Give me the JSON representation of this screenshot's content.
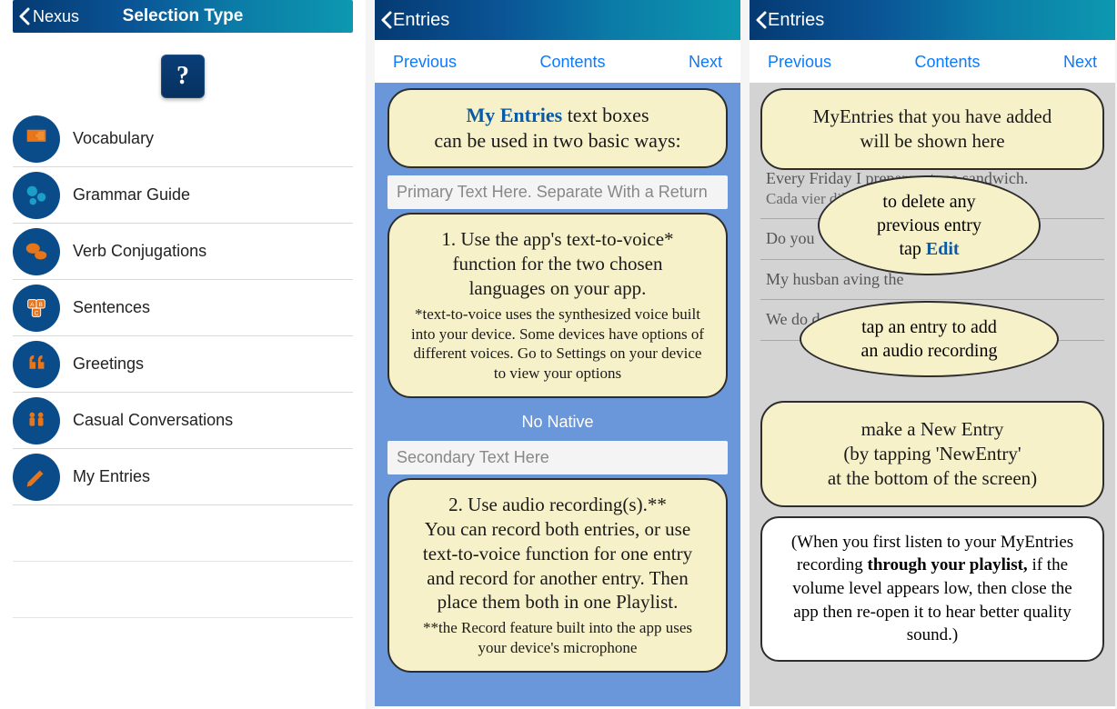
{
  "screen1": {
    "back_label": "Nexus",
    "title": "Selection Type",
    "help_glyph": "?",
    "items": [
      {
        "label": "Vocabulary"
      },
      {
        "label": "Grammar Guide"
      },
      {
        "label": "Verb Conjugations"
      },
      {
        "label": "Sentences"
      },
      {
        "label": "Greetings"
      },
      {
        "label": "Casual Conversations"
      },
      {
        "label": "My Entries"
      }
    ]
  },
  "nav": {
    "prev": "Previous",
    "contents": "Contents",
    "next": "Next"
  },
  "screen2": {
    "back_label": "Entries",
    "bubble1_a": "My Entries",
    "bubble1_b": " text boxes",
    "bubble1_c": "can be used in two basic ways:",
    "input1_placeholder": "Primary Text Here. Separate With a Return",
    "bubble2_mid_a": "1. Use the app's text-to-voice*",
    "bubble2_mid_b": "function for the two chosen",
    "bubble2_mid_c": "languages on your app.",
    "bubble2_small": "*text-to-voice uses the synthesized voice built into your device. Some devices have options of different voices. Go to Settings on your device to view your options",
    "no_native": "No Native",
    "input2_placeholder": "Secondary Text Here",
    "bubble3_mid_a": "2. Use audio recording(s).**",
    "bubble3_mid_b": "You can record both entries, or use text-to-voice function for one entry and record for another entry. Then place them both in one Playlist.",
    "bubble3_small": "**the Record feature built into the app uses your device's microphone"
  },
  "screen3": {
    "back_label": "Entries",
    "bubble_top_a": "MyEntries that you have added",
    "bubble_top_b": "will be shown here",
    "list": {
      "row1_a": "Every Friday I prepare a tuna sandwich.",
      "row1_b": "Cada vier                                              dillo de a...",
      "row2": "Do you",
      "row3": "My husban                                              aving the",
      "row4": "We do                                                            d"
    },
    "oval1_a": "to delete any",
    "oval1_b": "previous entry",
    "oval1_c": "tap ",
    "oval1_edit": "Edit",
    "oval2_a": "tap an entry to add",
    "oval2_b": "an audio recording",
    "bubble_mid_a": "make a New Entry",
    "bubble_mid_b": "(by tapping 'NewEntry'",
    "bubble_mid_c": "at the bottom of the screen)",
    "white_a": "(When you first listen to your MyEntries recording ",
    "white_bold": "through your playlist,",
    "white_b": " if the volume level appears low, then close the app then re-open it to hear better quality sound.)"
  }
}
